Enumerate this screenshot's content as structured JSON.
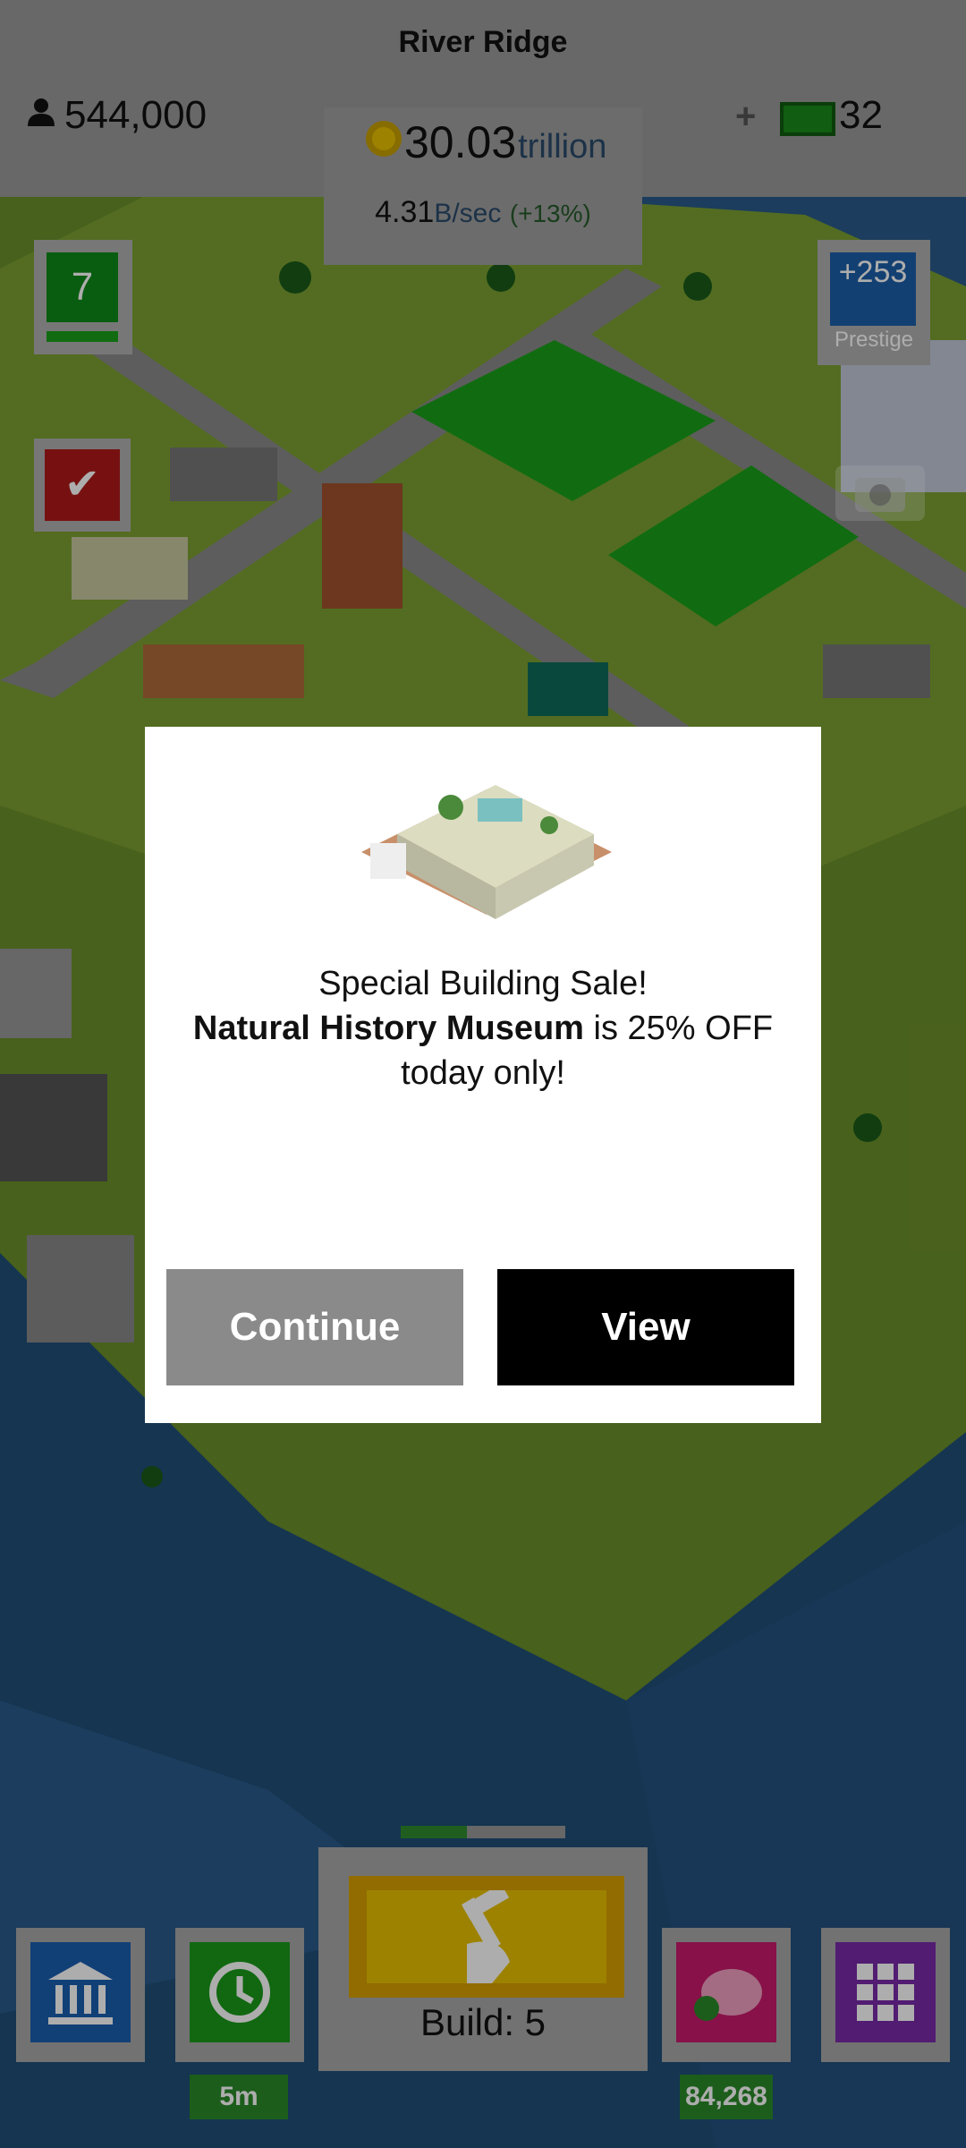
{
  "header": {
    "city_name": "River Ridge",
    "population": "544,000",
    "coins_value": "30.03",
    "coins_unit": "trillion",
    "rate_value": "4.31",
    "rate_unit": "B/sec",
    "rate_bonus": "(+13%)",
    "plus_label": "+",
    "cash_value": "32"
  },
  "left_widgets": {
    "level": "7",
    "check_icon": "check-icon"
  },
  "right_widgets": {
    "prestige_value": "+253",
    "prestige_label": "Prestige"
  },
  "dialog": {
    "line1": "Special Building Sale!",
    "building_name": "Natural History Museum",
    "line2_rest": " is 25% OFF",
    "line3": "today only!",
    "continue_label": "Continue",
    "view_label": "View"
  },
  "bottom": {
    "build_label": "Build: 5",
    "build_progress": 0.4,
    "time_badge": "5m",
    "piggy_badge": "84,268",
    "icons": [
      "bank-icon",
      "clock-icon",
      "piggy-bank-icon",
      "grid-icon",
      "hammer-icon"
    ]
  },
  "colors": {
    "accent_green": "#1a9a1a",
    "view_button": "#000000",
    "continue_button": "#8a8a8a"
  }
}
